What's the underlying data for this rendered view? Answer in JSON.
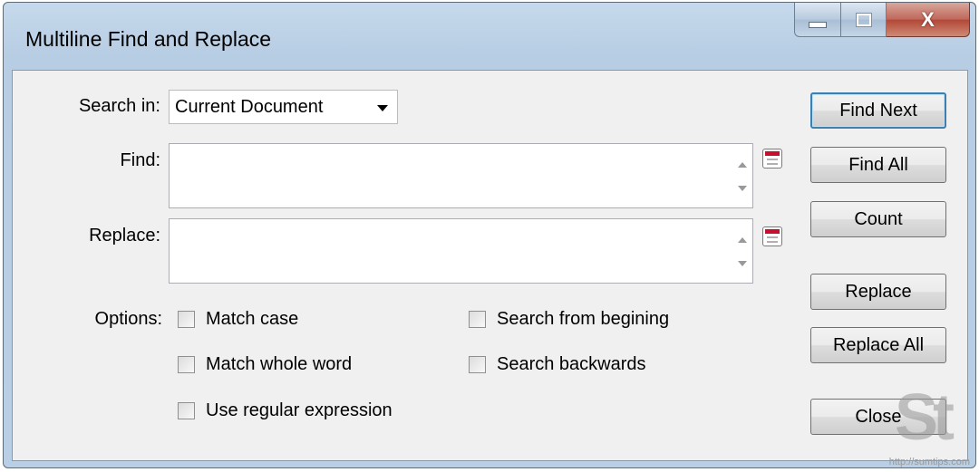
{
  "window": {
    "title": "Multiline Find and Replace",
    "controls": {
      "minimize": "minimize-icon",
      "maximize": "maximize-icon",
      "close": "X"
    }
  },
  "search_in": {
    "label": "Search in:",
    "value": "Current Document"
  },
  "find": {
    "label": "Find:",
    "value": ""
  },
  "replace": {
    "label": "Replace:",
    "value": ""
  },
  "options": {
    "label": "Options:",
    "items": [
      {
        "label": "Match case",
        "checked": false
      },
      {
        "label": "Match whole word",
        "checked": false
      },
      {
        "label": "Use regular expression",
        "checked": false
      },
      {
        "label": "Search from begining",
        "checked": false
      },
      {
        "label": "Search backwards",
        "checked": false
      }
    ]
  },
  "buttons": {
    "find_next": "Find Next",
    "find_all": "Find All",
    "count": "Count",
    "replace": "Replace",
    "replace_all": "Replace All",
    "close": "Close"
  },
  "watermark": {
    "logo": "St",
    "url": "http://sumtips.com"
  },
  "colors": {
    "titlebar": "#b9cfe5",
    "client": "#f0f0f0",
    "default_button_border": "#3c7fb1"
  }
}
